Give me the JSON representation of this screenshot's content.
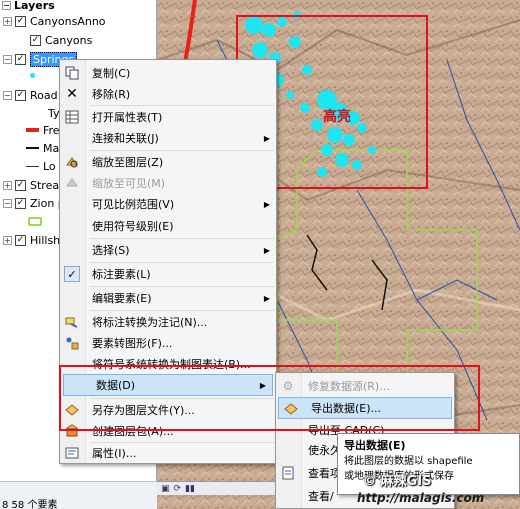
{
  "toc": {
    "header": "Layers",
    "layers": [
      {
        "name": "CanyonsAnno",
        "checked": true
      },
      {
        "name": "Canyons",
        "checked": true
      },
      {
        "name": "Springs",
        "checked": true,
        "selected": true
      },
      {
        "name": "Road",
        "checked": true
      },
      {
        "name": "Ty",
        "checked": false
      },
      {
        "name": "Fre",
        "checked": false
      },
      {
        "name": "Ma",
        "checked": false
      },
      {
        "name": "Lo",
        "checked": false
      },
      {
        "name": "Strea",
        "checked": true
      },
      {
        "name": "Zion p",
        "checked": true
      },
      {
        "name": "Hillsh",
        "checked": true
      }
    ],
    "status": "8 58 个要素"
  },
  "map": {
    "highlight_label": "高亮",
    "toolbar_icons": [
      "page-icon",
      "refresh-icon",
      "pause-icon"
    ]
  },
  "context_menu": {
    "items": [
      {
        "label": "复制(C)",
        "icon": "copy-icon"
      },
      {
        "label": "移除(R)",
        "icon": "remove-icon"
      },
      {
        "label": "打开属性表(T)",
        "icon": "table-icon"
      },
      {
        "label": "连接和关联(J)",
        "submenu": true
      },
      {
        "label": "缩放至图层(Z)",
        "icon": "zoom-to-layer-icon"
      },
      {
        "label": "缩放至可见(M)",
        "disabled": true,
        "icon": "zoom-visible-icon"
      },
      {
        "label": "可见比例范围(V)",
        "submenu": true
      },
      {
        "label": "使用符号级别(E)"
      },
      {
        "label": "选择(S)",
        "submenu": true
      },
      {
        "label": "标注要素(L)",
        "checked": true,
        "icon": "check-icon"
      },
      {
        "label": "编辑要素(E)",
        "submenu": true
      },
      {
        "label": "将标注转换为注记(N)...",
        "icon": "convert-label-icon"
      },
      {
        "label": "要素转图形(F)...",
        "icon": "features-graphics-icon"
      },
      {
        "label": "将符号系统转换为制图表达(B)..."
      },
      {
        "label": "数据(D)",
        "submenu": true,
        "highlighted": true
      },
      {
        "label": "另存为图层文件(Y)...",
        "icon": "layer-file-icon"
      },
      {
        "label": "创建图层包(A)...",
        "icon": "layer-package-icon"
      },
      {
        "label": "属性(I)...",
        "icon": "properties-icon"
      }
    ]
  },
  "data_submenu": {
    "items": [
      {
        "label": "修复数据源(R)...",
        "disabled": true,
        "icon": "repair-icon"
      },
      {
        "label": "导出数据(E)...",
        "highlighted": true,
        "icon": "export-icon"
      },
      {
        "label": "导出至 CAD(C)"
      },
      {
        "label": "使永久"
      },
      {
        "label": "查看项",
        "icon": "view-item-icon"
      },
      {
        "label": "查看/"
      }
    ]
  },
  "tooltip": {
    "title": "导出数据(E)",
    "body_line1": "将此图层的数据以 shapefile",
    "body_line2": "或地理数据库的形式保存"
  },
  "watermark": {
    "text": "© 麻辣GIS",
    "url": "http://malagis.com"
  },
  "colors": {
    "selection_blue": "#3399ff",
    "menu_highlight": "#cce4f7",
    "red_frame": "#e0101e",
    "springs_cyan": "#1ee6f0"
  }
}
